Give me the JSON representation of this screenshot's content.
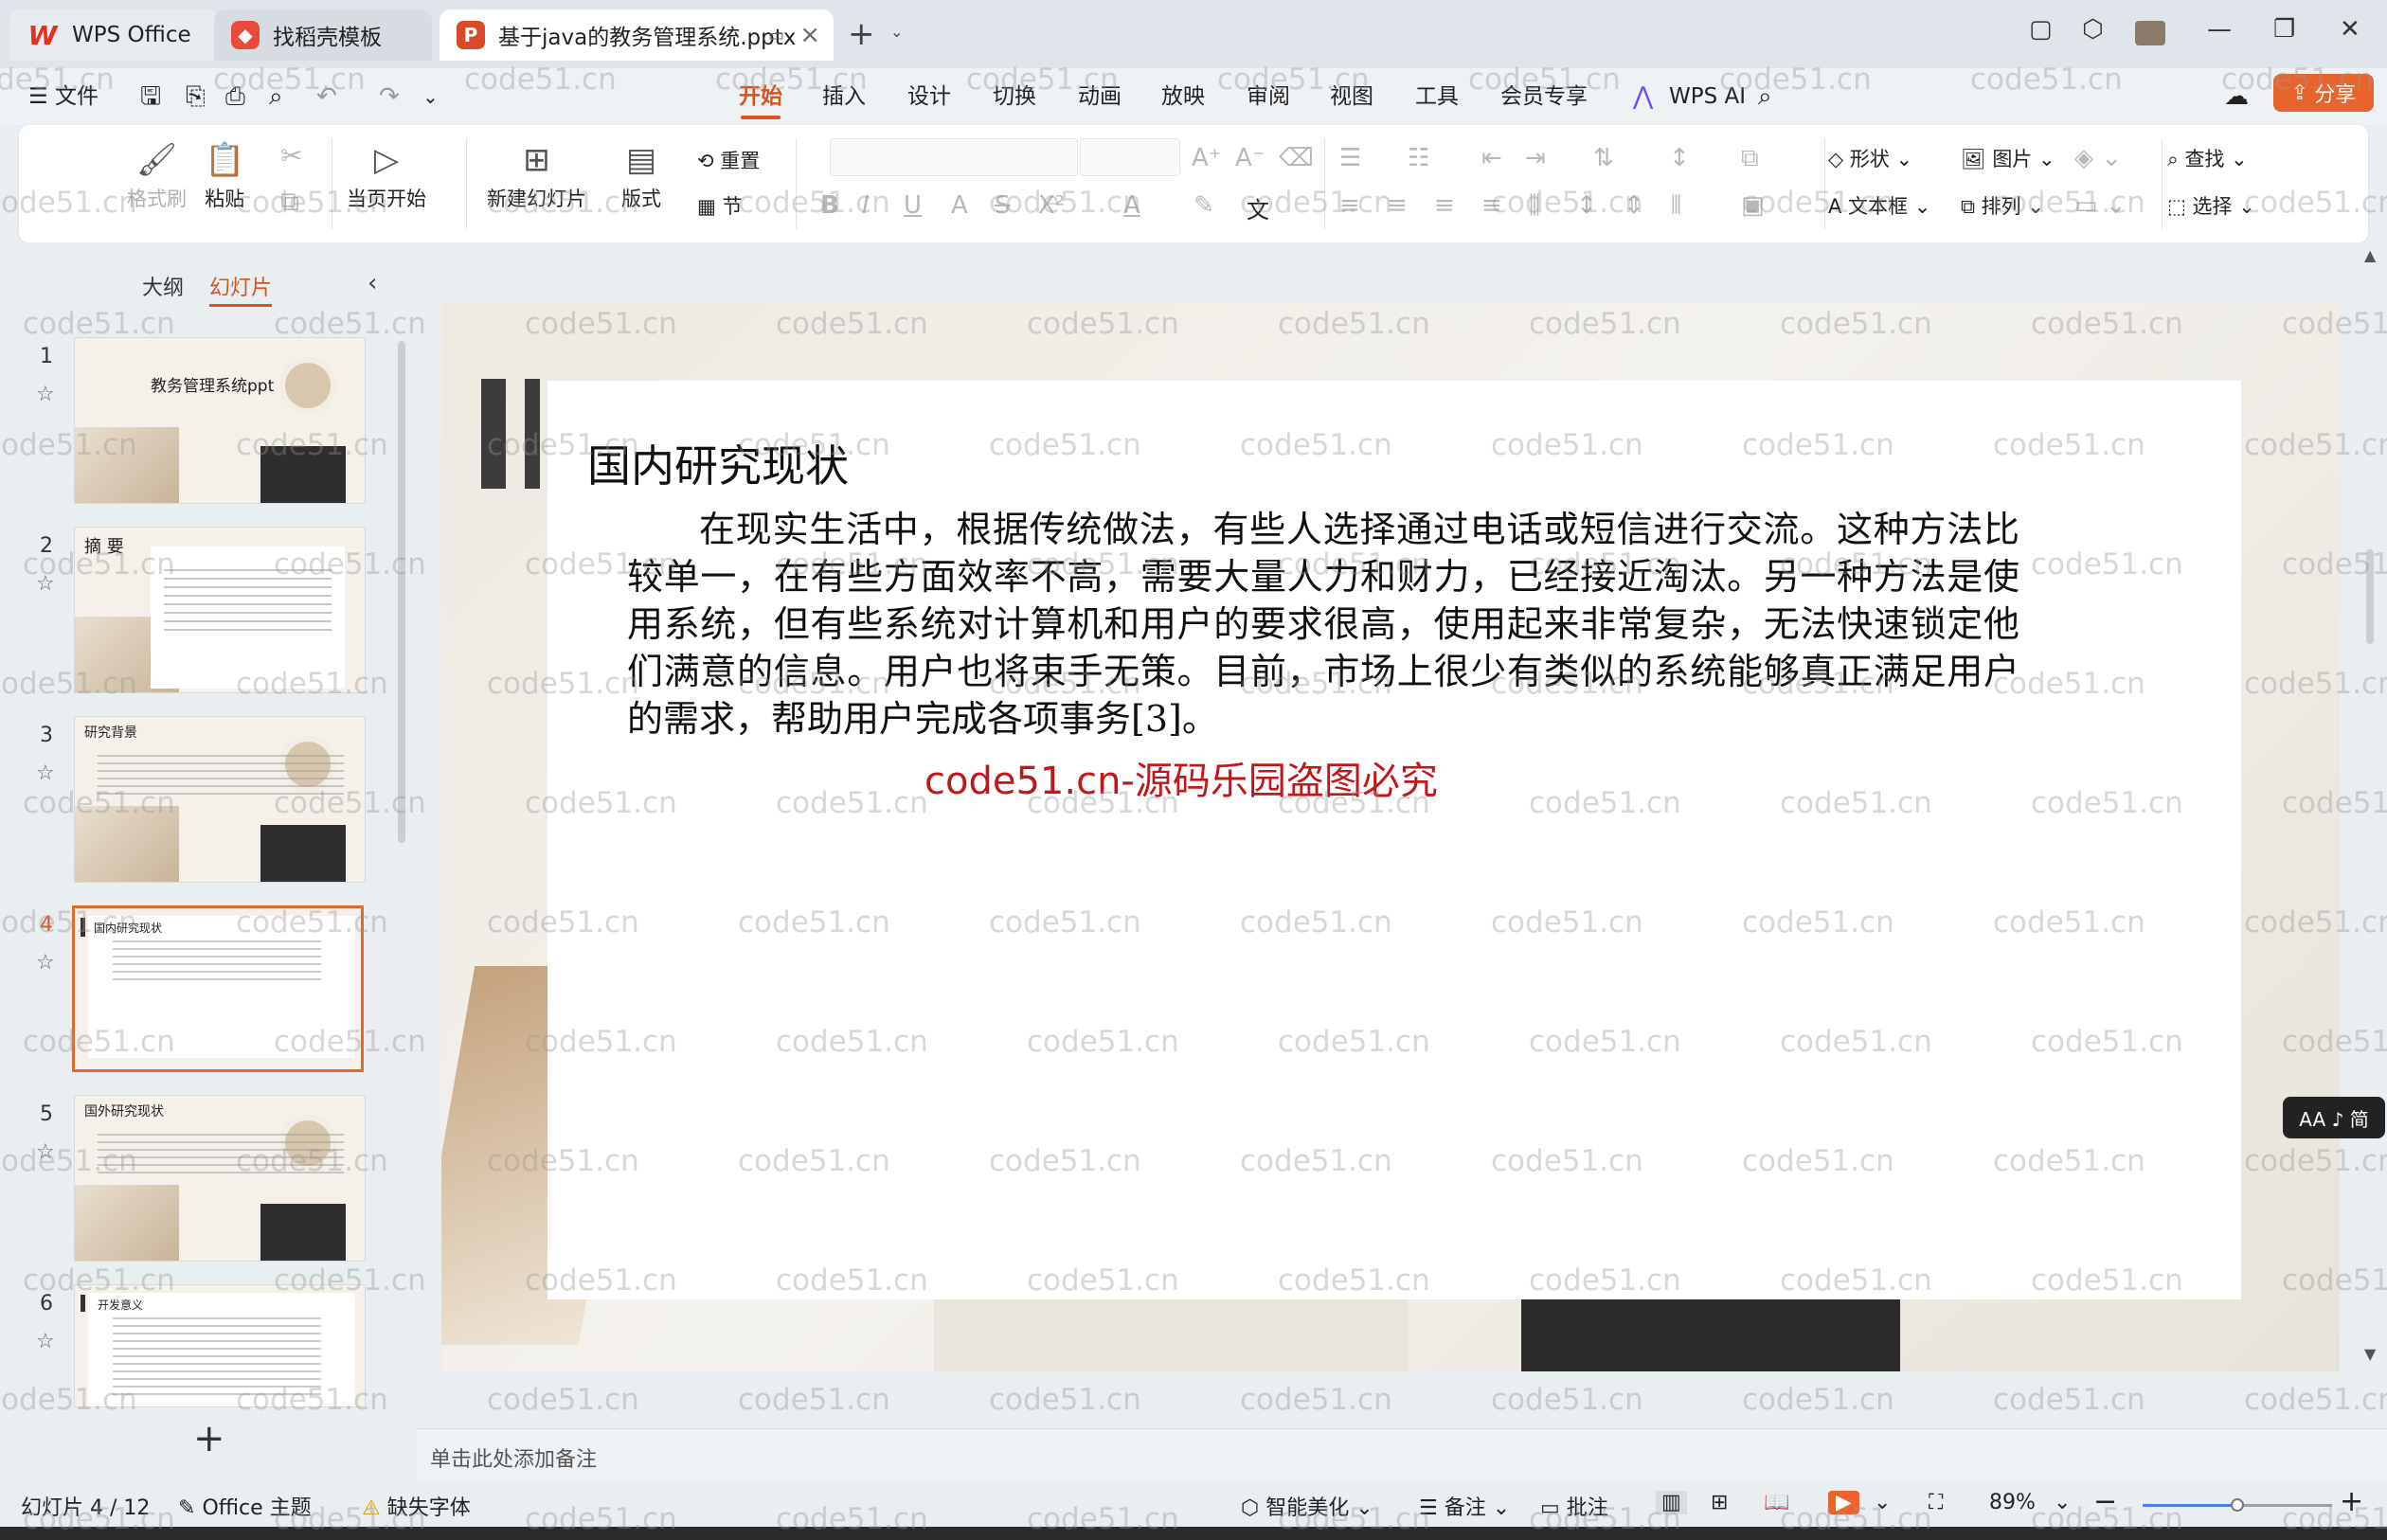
{
  "titlebar": {
    "tabs": [
      {
        "label": "WPS Office"
      },
      {
        "label": "找稻壳模板"
      },
      {
        "label": "基于java的教务管理系统.pptx"
      }
    ],
    "new_tab": "+"
  },
  "menu": {
    "file": "文件",
    "items": [
      "开始",
      "插入",
      "设计",
      "切换",
      "动画",
      "放映",
      "审阅",
      "视图",
      "工具",
      "会员专享"
    ],
    "active": "开始",
    "wps_ai": "WPS AI",
    "share": "分享"
  },
  "ribbon": {
    "format_painter": "格式刷",
    "paste": "粘贴",
    "play_from_current": "当页开始",
    "new_slide": "新建幻灯片",
    "layout": "版式",
    "reset": "重置",
    "section": "节",
    "shape": "形状",
    "picture": "图片",
    "find": "查找",
    "textbox": "文本框",
    "arrange": "排列",
    "select": "选择"
  },
  "left_panel": {
    "tabs": [
      "大纲",
      "幻灯片"
    ],
    "active_tab": "幻灯片",
    "slides": [
      {
        "num": "1",
        "title": "教务管理系统ppt"
      },
      {
        "num": "2",
        "title": "摘 要"
      },
      {
        "num": "3",
        "title": "研究背景"
      },
      {
        "num": "4",
        "title": "国内研究现状"
      },
      {
        "num": "5",
        "title": "国外研究现状"
      },
      {
        "num": "6",
        "title": "开发意义"
      }
    ],
    "selected": "4"
  },
  "slide": {
    "title": "国内研究现状",
    "body": "在现实生活中，根据传统做法，有些人选择通过电话或短信进行交流。这种方法比较单一，在有些方面效率不高，需要大量人力和财力，已经接近淘汰。另一种方法是使用系统，但有些系统对计算机和用户的要求很高，使用起来非常复杂，无法快速锁定他们满意的信息。用户也将束手无策。目前，市场上很少有类似的系统能够真正满足用户的需求，帮助用户完成各项事务[3]。",
    "red_text": "code51.cn-源码乐园盗图必究"
  },
  "aa_badge": "AA ♪ 简",
  "notes_placeholder": "单击此处添加备注",
  "status": {
    "slide_counter": "幻灯片 4 / 12",
    "theme": "Office 主题",
    "missing_font": "缺失字体",
    "smart_beautify": "智能美化",
    "notes": "备注",
    "comments": "批注",
    "zoom": "89%",
    "zoom_fraction": 0.5
  },
  "watermark": "code51.cn",
  "colors": {
    "accent": "#d9531e",
    "share_button": "#e8642c",
    "red_text": "#c0181a"
  }
}
